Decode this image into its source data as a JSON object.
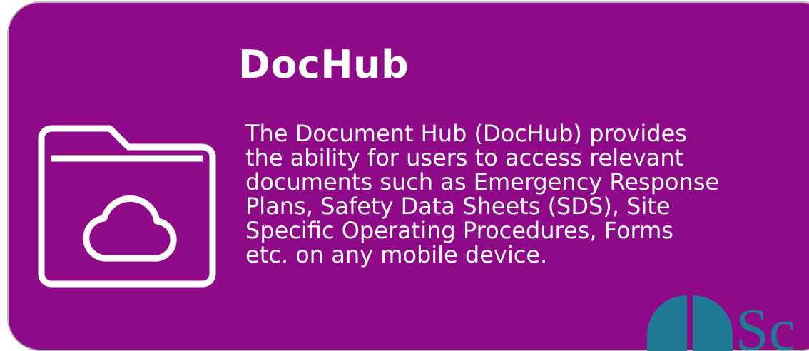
{
  "card": {
    "title": "DocHub",
    "description": "The Document Hub (DocHub) provides\nthe ability for users to access relevant\ndocuments such as Emergency Response\nPlans, Safety Data Sheets (SDS), Site\nSpecific Operating Procedures, Forms\netc. on any mobile device.",
    "icon": "folder-cloud-icon"
  },
  "logo": {
    "icon": "brand-logo-icon",
    "text": "Sc"
  },
  "colors": {
    "card_background": "#8e0a88",
    "text": "#ffffff",
    "logo_teal": "#1f7a96"
  }
}
